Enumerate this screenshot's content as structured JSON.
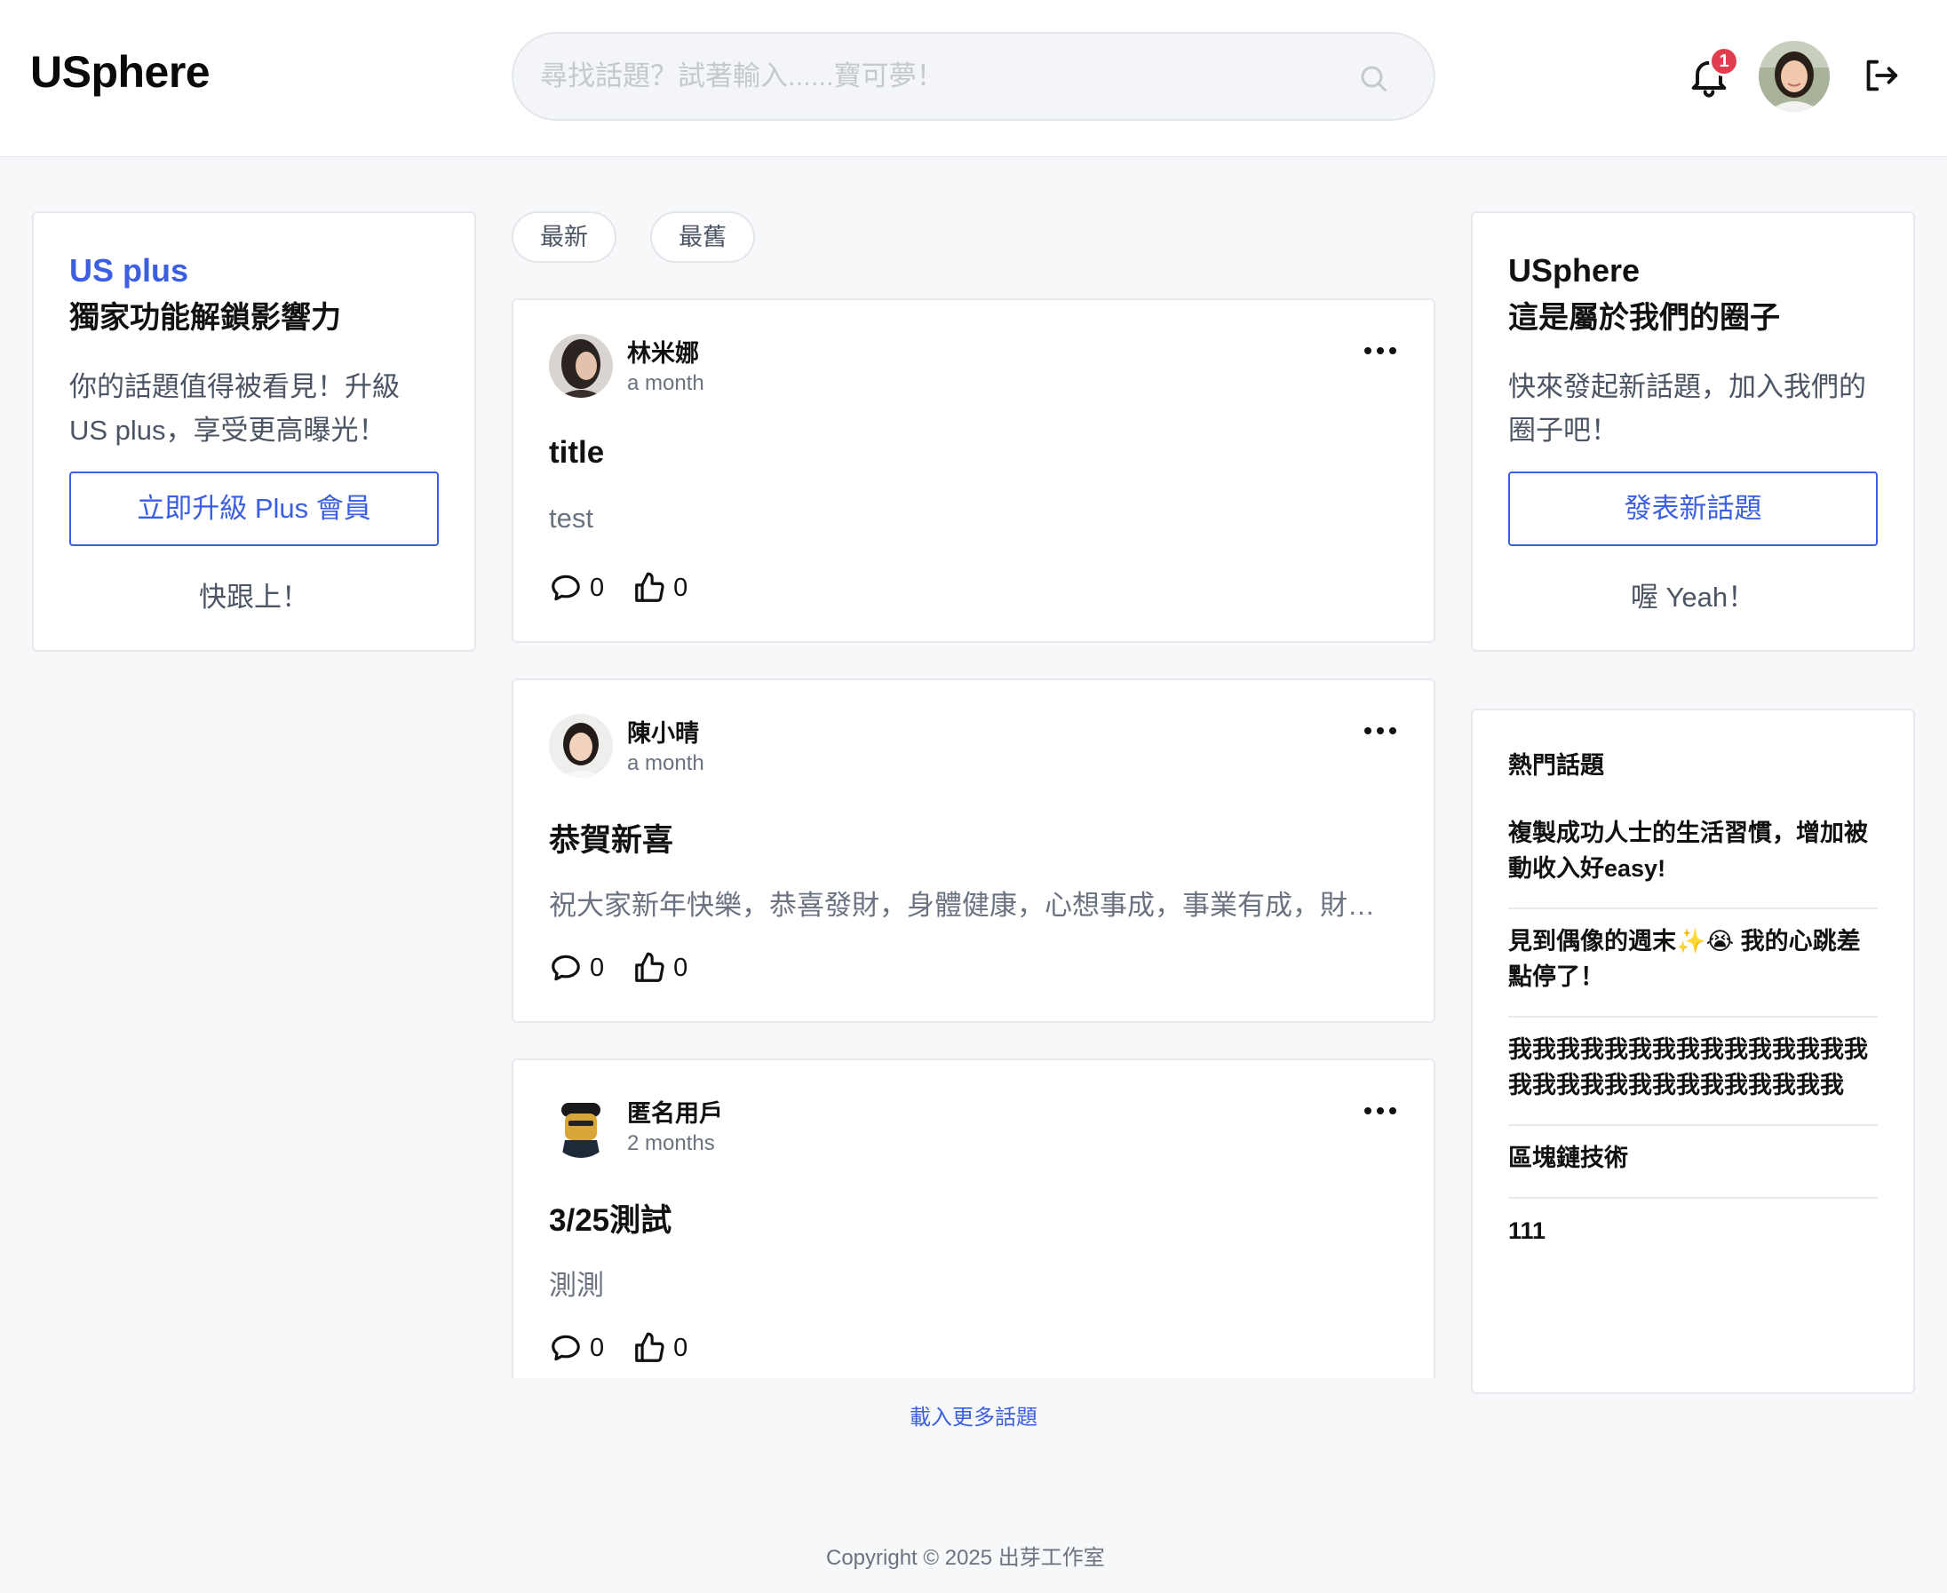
{
  "header": {
    "logo": "USphere",
    "search_placeholder": "尋找話題？試著輸入......寶可夢！",
    "notification_count": "1"
  },
  "left_promo": {
    "accent": "US plus",
    "title": "獨家功能解鎖影響力",
    "description": "你的話題值得被看見！升級 US plus，享受更高曝光！",
    "button_label": "立即升級 Plus 會員",
    "footer": "快跟上！"
  },
  "filters": {
    "newest": "最新",
    "oldest": "最舊"
  },
  "posts": [
    {
      "author": "林米娜",
      "time": "a month",
      "title": "title",
      "body": "test",
      "comments": "0",
      "likes": "0"
    },
    {
      "author": "陳小晴",
      "time": "a month",
      "title": "恭賀新喜",
      "body": "祝大家新年快樂，恭喜發財，身體健康，心想事成，事業有成，財源廣進",
      "comments": "0",
      "likes": "0"
    },
    {
      "author": "匿名用戶",
      "time": "2 months",
      "title": "3/25測試",
      "body": "測測",
      "comments": "0",
      "likes": "0"
    }
  ],
  "load_more": "載入更多話題",
  "right_promo": {
    "accent": "USphere",
    "title": "這是屬於我們的圈子",
    "description": "快來發起新話題，加入我們的圈子吧！",
    "button_label": "發表新話題",
    "footer": "喔 Yeah！"
  },
  "hot_topics": {
    "heading": "熱門話題",
    "items": [
      "複製成功人士的生活習慣，增加被動收入好easy!",
      "見到偶像的週末✨😭 我的心跳差點停了！",
      "我我我我我我我我我我我我我我我 我我我我我我我我我我我我我我",
      "區塊鏈技術",
      "111"
    ]
  },
  "footer": {
    "copyright": "Copyright © 2025 出芽工作室"
  },
  "colors": {
    "accent": "#3b5fe0",
    "badge": "#e23d4f",
    "page_bg": "#f7f8fa"
  }
}
